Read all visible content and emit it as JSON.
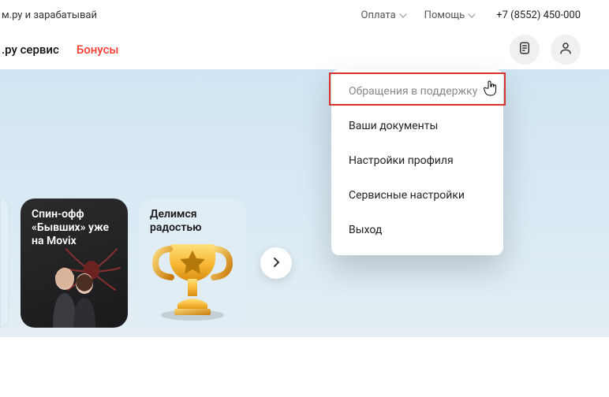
{
  "topbar": {
    "promo_text": "м.ру и зарабатывай",
    "pay_label": "Оплата",
    "help_label": "Помощь",
    "phone": "+7 (8552) 450-000"
  },
  "nav": {
    "service_label": ".ру сервис",
    "bonus_label": "Бонусы",
    "icons": {
      "doc": "document-icon",
      "profile": "profile-icon"
    }
  },
  "cards": {
    "c1": {
      "title": "Спин-офф «Бывших» уже на Movix"
    },
    "c2": {
      "title": "Делимся радостью"
    }
  },
  "menu": {
    "items": {
      "support": "Обращения в поддержку",
      "docs": "Ваши документы",
      "profile": "Настройки профиля",
      "service": "Сервисные настройки",
      "logout": "Выход"
    }
  }
}
